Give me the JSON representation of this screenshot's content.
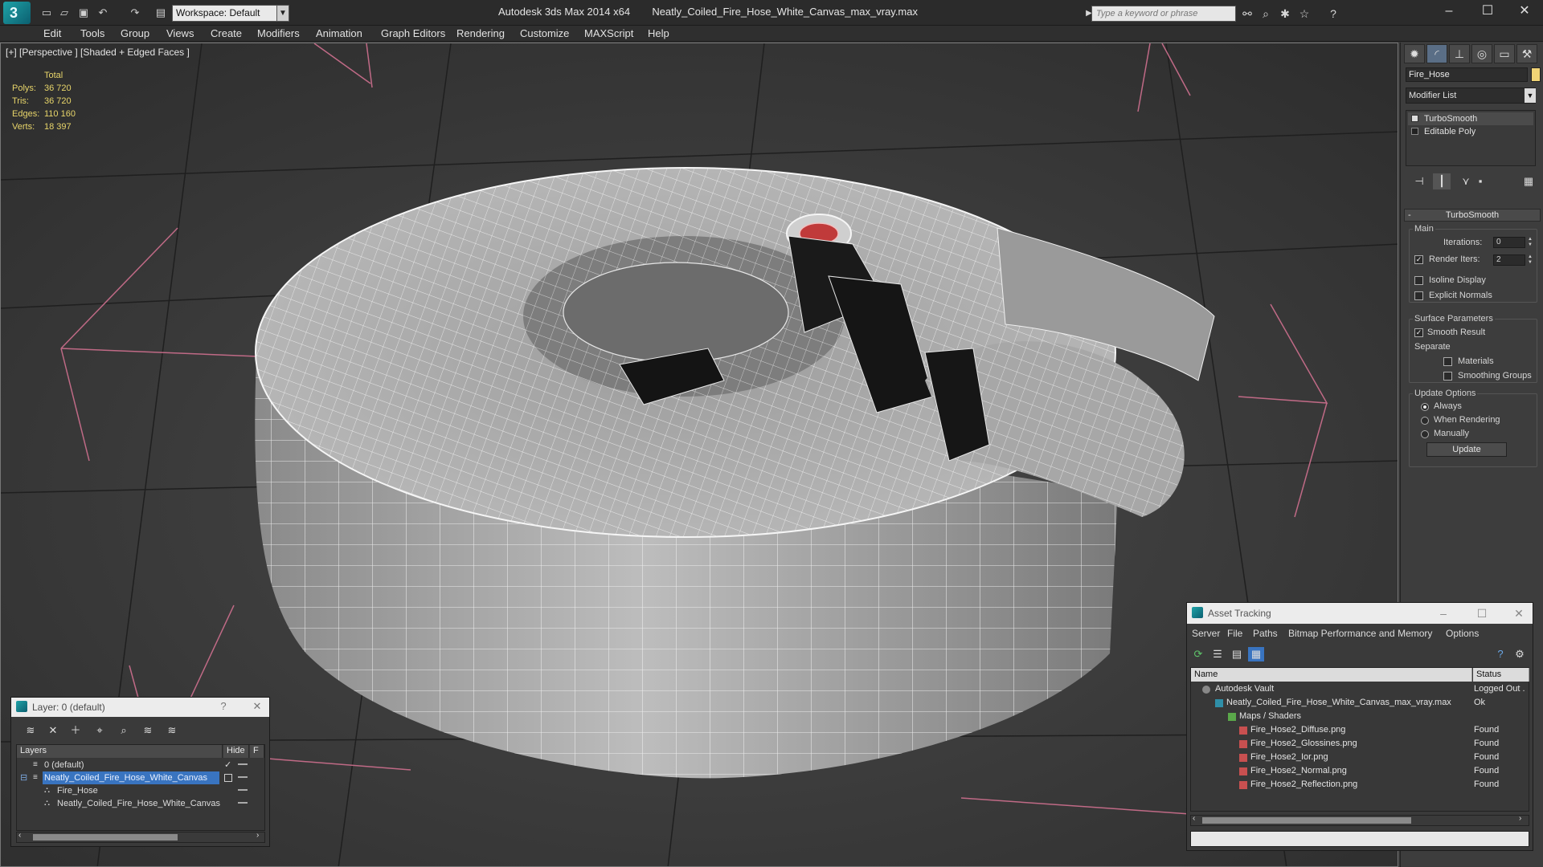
{
  "app": {
    "title": "Autodesk 3ds Max  2014 x64",
    "file": "Neatly_Coiled_Fire_Hose_White_Canvas_max_vray.max",
    "workspace": "Workspace: Default",
    "search_placeholder": "Type a keyword or phrase"
  },
  "menu": [
    "Edit",
    "Tools",
    "Group",
    "Views",
    "Create",
    "Modifiers",
    "Animation",
    "Graph Editors",
    "Rendering",
    "Customize",
    "MAXScript",
    "Help"
  ],
  "viewport": {
    "label": "[+] [Perspective ] [Shaded + Edged Faces ]",
    "stats": {
      "header": "Total",
      "rows": [
        {
          "k": "Polys:",
          "v": "36 720"
        },
        {
          "k": "Tris:",
          "v": "36 720"
        },
        {
          "k": "Edges:",
          "v": "110 160"
        },
        {
          "k": "Verts:",
          "v": "18 397"
        }
      ]
    }
  },
  "command_panel": {
    "object_name": "Fire_Hose",
    "modifier_list": "Modifier List",
    "stack": [
      "TurboSmooth",
      "Editable Poly"
    ],
    "rollout": "TurboSmooth",
    "main_group": "Main",
    "iterations_label": "Iterations:",
    "iterations_value": "0",
    "render_iters_label": "Render Iters:",
    "render_iters_value": "2",
    "isoline": "Isoline Display",
    "explicit_normals": "Explicit Normals",
    "surface_params": "Surface Parameters",
    "smooth_result": "Smooth Result",
    "separate": "Separate",
    "materials": "Materials",
    "smoothing_groups": "Smoothing Groups",
    "update_options": "Update Options",
    "always": "Always",
    "when_rendering": "When Rendering",
    "manually": "Manually",
    "update_button": "Update"
  },
  "layer_panel": {
    "title": "Layer: 0 (default)",
    "help": "?",
    "col_layers": "Layers",
    "col_hide": "Hide",
    "col_f": "F",
    "rows": [
      {
        "name": "0 (default)"
      },
      {
        "name": "Neatly_Coiled_Fire_Hose_White_Canvas"
      },
      {
        "name": "Fire_Hose"
      },
      {
        "name": "Neatly_Coiled_Fire_Hose_White_Canvas"
      }
    ]
  },
  "asset_panel": {
    "title": "Asset Tracking",
    "menu": [
      "Server",
      "File",
      "Paths",
      "Bitmap Performance and Memory",
      "Options"
    ],
    "col_name": "Name",
    "col_status": "Status",
    "rows": [
      {
        "name": "Autodesk Vault",
        "status": "Logged Out ."
      },
      {
        "name": "Neatly_Coiled_Fire_Hose_White_Canvas_max_vray.max",
        "status": "Ok"
      },
      {
        "name": "Maps / Shaders",
        "status": ""
      },
      {
        "name": "Fire_Hose2_Diffuse.png",
        "status": "Found"
      },
      {
        "name": "Fire_Hose2_Glossines.png",
        "status": "Found"
      },
      {
        "name": "Fire_Hose2_Ior.png",
        "status": "Found"
      },
      {
        "name": "Fire_Hose2_Normal.png",
        "status": "Found"
      },
      {
        "name": "Fire_Hose2_Reflection.png",
        "status": "Found"
      }
    ]
  },
  "colors": {
    "stats_text": "#e8d56a",
    "selection": "#3974c0",
    "object_color": "#f1d476"
  }
}
